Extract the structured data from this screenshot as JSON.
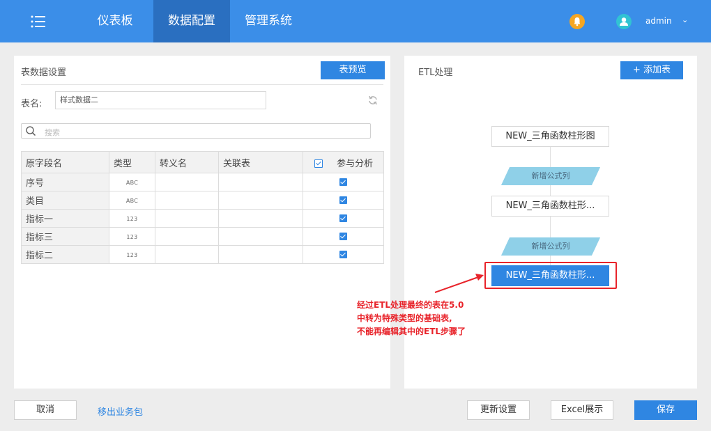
{
  "nav": {
    "items": [
      {
        "label": "仪表板"
      },
      {
        "label": "数据配置"
      },
      {
        "label": "管理系统"
      }
    ],
    "user": "admin"
  },
  "left_panel": {
    "title": "表数据设置",
    "preview_button": "表预览",
    "table_name_label": "表名:",
    "table_name_value": "样式数据二",
    "search_placeholder": "搜索",
    "columns": [
      "原字段名",
      "类型",
      "转义名",
      "关联表",
      "参与分析"
    ],
    "rows": [
      {
        "name": "序号",
        "type": "ABC",
        "alias": "",
        "relation": "",
        "analyze": true
      },
      {
        "name": "类目",
        "type": "ABC",
        "alias": "",
        "relation": "",
        "analyze": true
      },
      {
        "name": "指标一",
        "type": "123",
        "alias": "",
        "relation": "",
        "analyze": true
      },
      {
        "name": "指标三",
        "type": "123",
        "alias": "",
        "relation": "",
        "analyze": true
      },
      {
        "name": "指标二",
        "type": "123",
        "alias": "",
        "relation": "",
        "analyze": true
      }
    ]
  },
  "right_panel": {
    "title": "ETL处理",
    "add_table_button": "+ 添加表",
    "nodes": [
      {
        "label": "NEW_三角函数柱形图"
      },
      {
        "label": "NEW_三角函数柱形..."
      },
      {
        "label": "NEW_三角函数柱形..."
      }
    ],
    "steps": [
      {
        "label": "新增公式列"
      },
      {
        "label": "新增公式列"
      }
    ],
    "annotation": {
      "line1": "经过ETL处理最终的表在5.0",
      "line2": "中转为特殊类型的基础表,",
      "line3": "不能再编辑其中的ETL步骤了"
    }
  },
  "footer": {
    "cancel": "取消",
    "export_link": "移出业务包",
    "update": "更新设置",
    "excel": "Excel展示",
    "save": "保存"
  },
  "colors": {
    "nav_bg": "#3b8ee8",
    "nav_active": "#2a6fc0",
    "primary": "#2f86e2",
    "annotation_red": "#e8232a",
    "step_fill": "#8fd0e8"
  }
}
